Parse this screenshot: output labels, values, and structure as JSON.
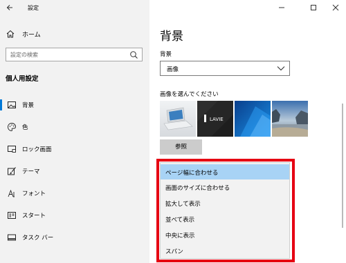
{
  "app": {
    "title": "設定"
  },
  "sidebar": {
    "home_label": "ホーム",
    "search_placeholder": "設定の検索",
    "section_title": "個人用設定",
    "items": [
      {
        "label": "背景",
        "icon": "image-icon",
        "active": true
      },
      {
        "label": "色",
        "icon": "palette-icon",
        "active": false
      },
      {
        "label": "ロック画面",
        "icon": "lock-screen-icon",
        "active": false
      },
      {
        "label": "テーマ",
        "icon": "brush-icon",
        "active": false
      },
      {
        "label": "フォント",
        "icon": "font-icon",
        "active": false
      },
      {
        "label": "スタート",
        "icon": "start-icon",
        "active": false
      },
      {
        "label": "タスク バー",
        "icon": "taskbar-icon",
        "active": false
      }
    ]
  },
  "main": {
    "heading": "背景",
    "background_label": "背景",
    "background_value": "画像",
    "choose_picture_label": "画像を選んでください",
    "browse_label": "参照",
    "fit_options": [
      "ページ幅に合わせる",
      "画面のサイズに合わせる",
      "拡大して表示",
      "並べて表示",
      "中央に表示",
      "スパン"
    ],
    "fit_selected": "ページ幅に合わせる",
    "thumb_brand_text": "LAVIE"
  },
  "colors": {
    "accent": "#0078d7",
    "highlight_frame": "#e60012",
    "selected_item": "#a8d3f5",
    "sidebar_bg": "#f2f2f2"
  }
}
